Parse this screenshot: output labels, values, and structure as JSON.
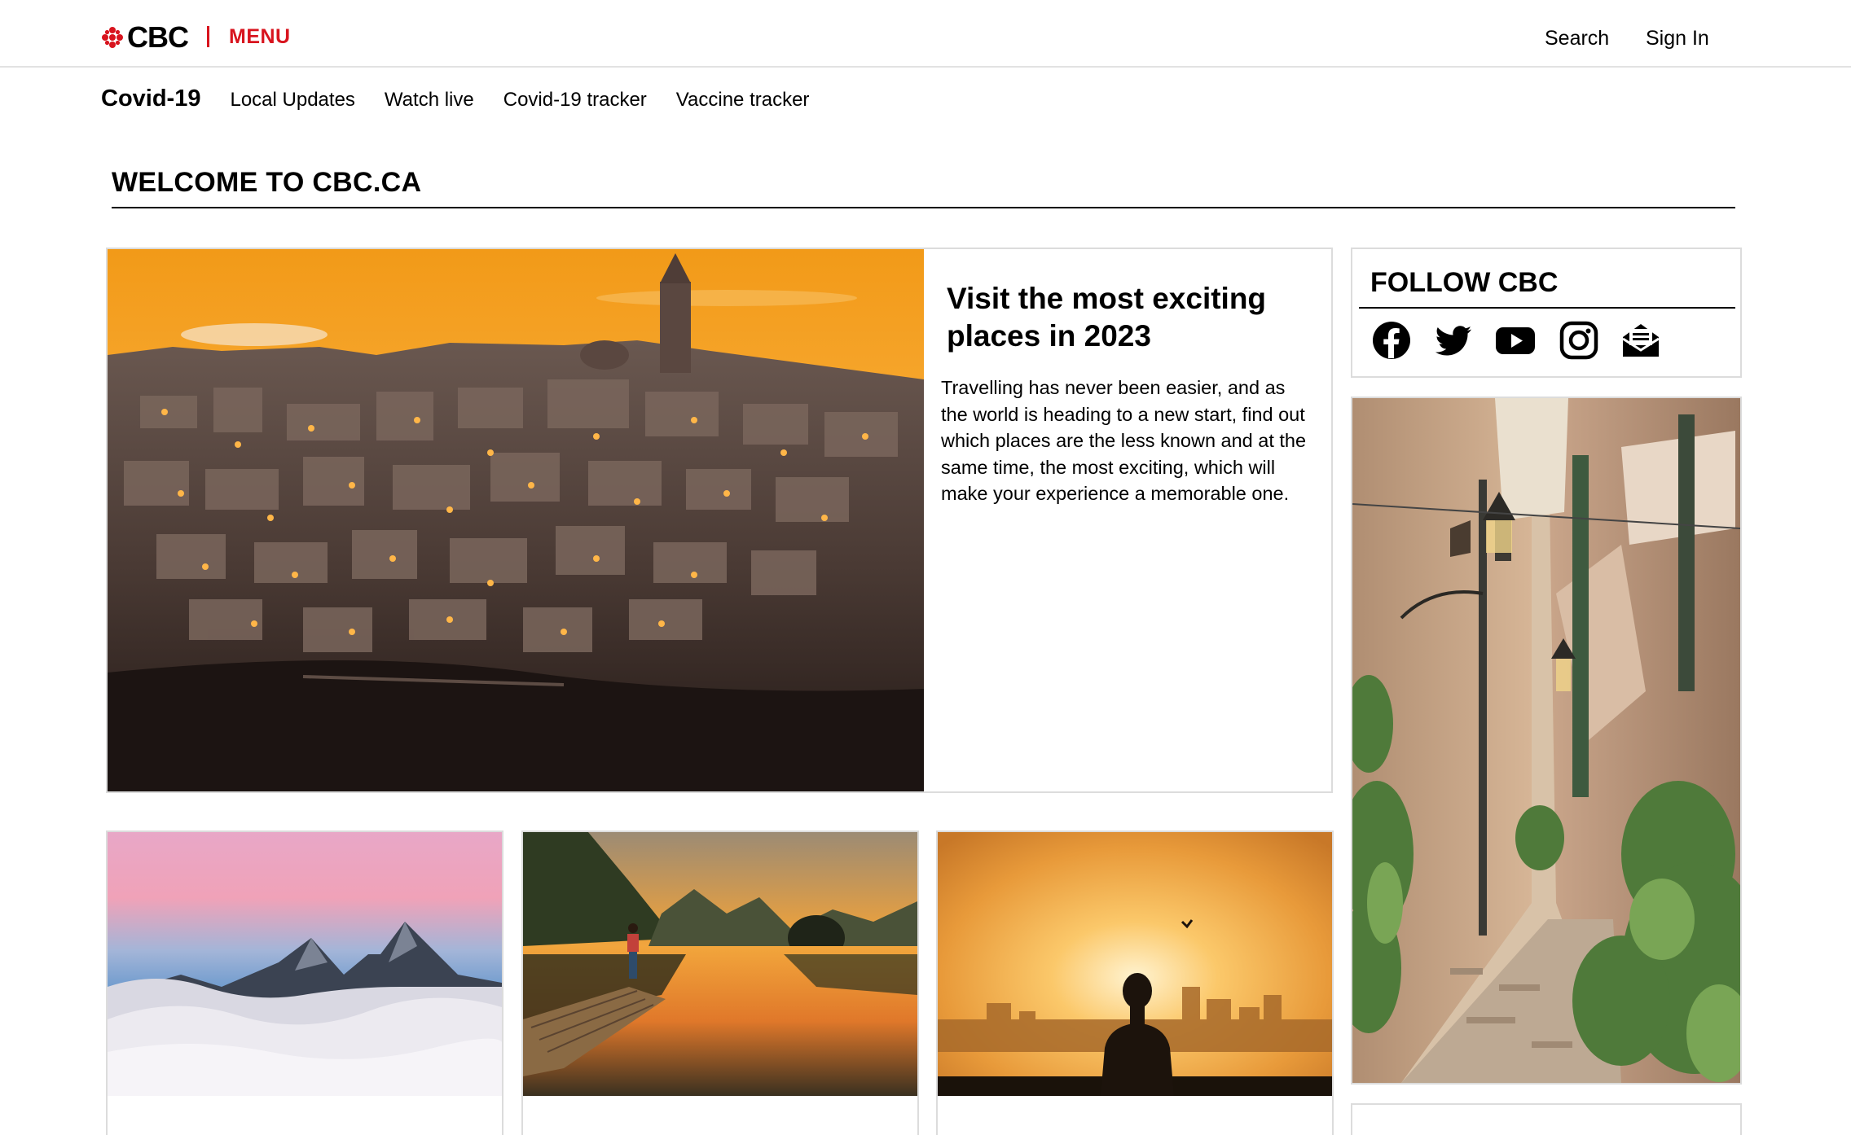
{
  "header": {
    "logo_text": "CBC",
    "menu_label": "MENU",
    "search_label": "Search",
    "signin_label": "Sign In",
    "brand_color": "#d8141e"
  },
  "subnav": {
    "title": "Covid-19",
    "items": [
      {
        "label": "Local Updates"
      },
      {
        "label": "Watch live"
      },
      {
        "label": "Covid-19 tracker"
      },
      {
        "label": "Vaccine tracker"
      }
    ]
  },
  "main": {
    "heading": "WELCOME TO CBC.CA",
    "feature": {
      "title": "Visit the most exciting places in 2023",
      "body": "Travelling has never been easier, and as the world is heading to a new start, find out which places are the less known and at the same time, the most exciting, which will make your experience a memorable one.",
      "image": "hilltop-town-at-sunset-photo"
    },
    "cards": [
      {
        "image": "mountain-peaks-above-clouds-photo"
      },
      {
        "image": "person-on-raft-at-sunset-lake-photo"
      },
      {
        "image": "silhouette-person-city-sunset-photo"
      }
    ]
  },
  "sidebar": {
    "follow_title": "FOLLOW CBC",
    "social_icons": [
      "facebook-icon",
      "twitter-icon",
      "youtube-icon",
      "instagram-icon",
      "newsletter-icon"
    ],
    "side_image": "narrow-stone-alley-with-lamps-photo"
  }
}
